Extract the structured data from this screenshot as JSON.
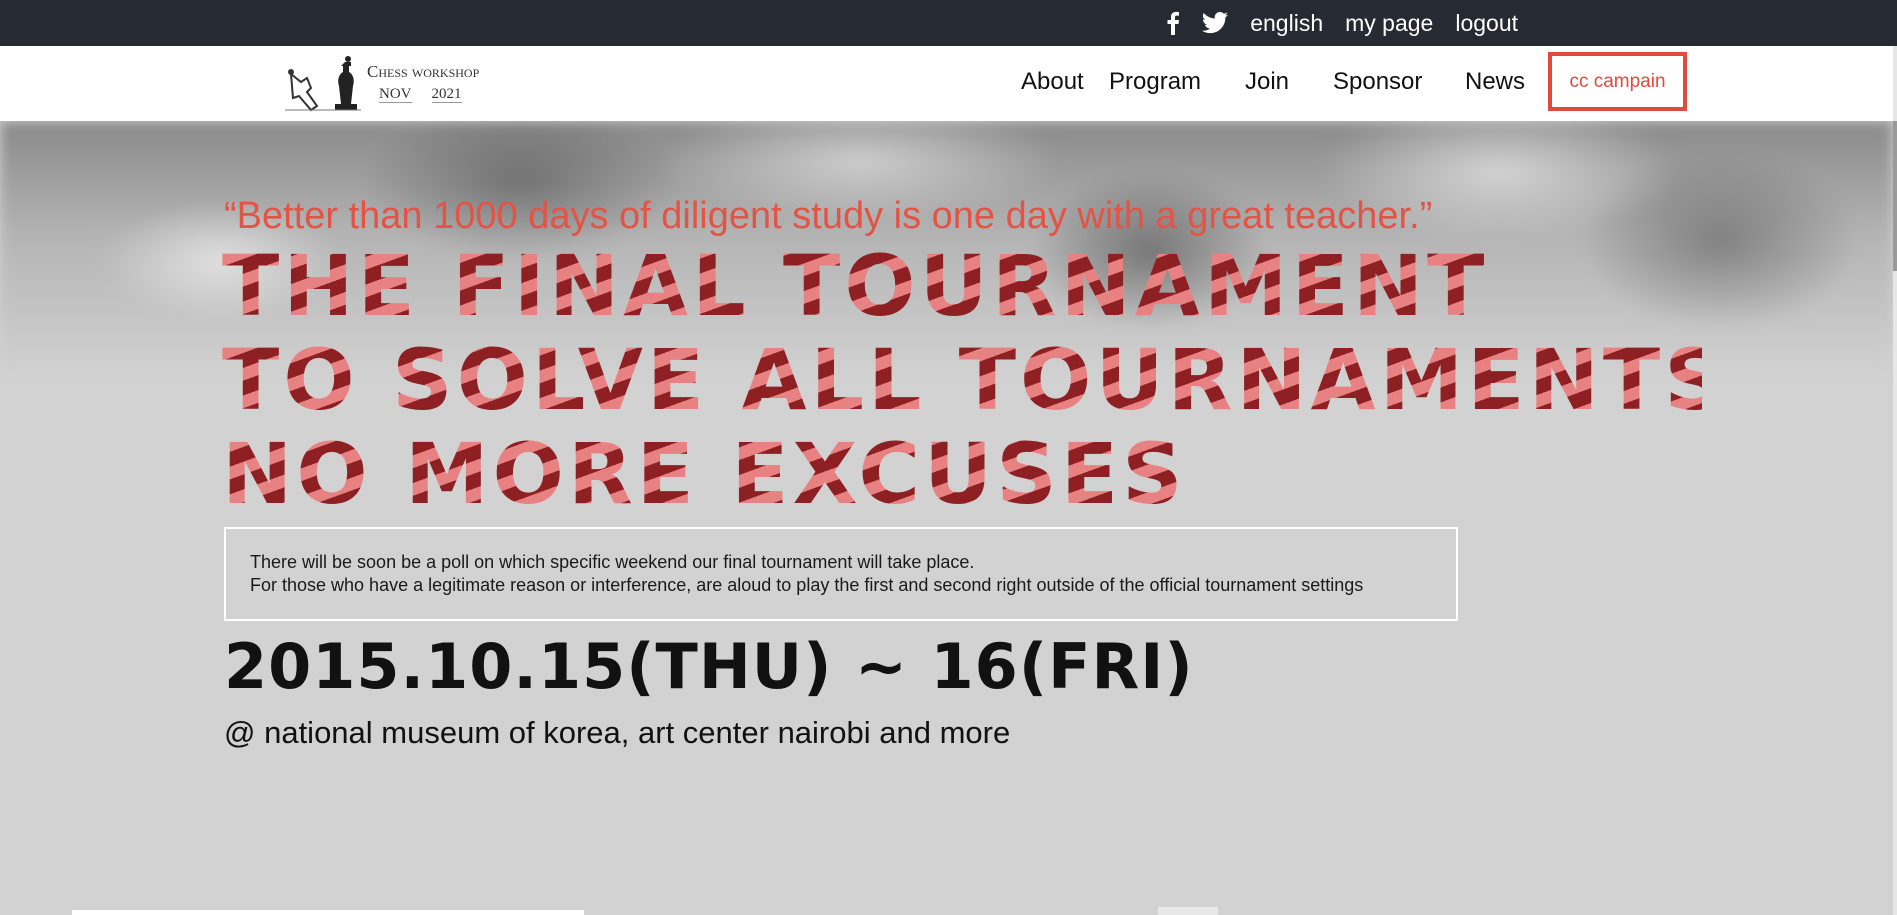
{
  "topbar": {
    "icons": [
      "facebook-icon",
      "twitter-icon"
    ],
    "language": "english",
    "my_page": "my page",
    "logout": "logout"
  },
  "logo": {
    "title": "Chess workshop",
    "month": "NOV",
    "year": "2021"
  },
  "nav": {
    "items": [
      {
        "label": "About"
      },
      {
        "label": "Program"
      },
      {
        "label": "Join"
      },
      {
        "label": "Sponsor"
      },
      {
        "label": "News"
      }
    ],
    "cta": "cc campain"
  },
  "hero": {
    "quote": "“Better than 1000 days of diligent study is one day with a great teacher.”",
    "headline": [
      "THE FINAL TOURNAMENT",
      "TO SOLVE ALL TOURNAMENTS",
      "NO MORE EXCUSES"
    ],
    "notice": [
      "There will be soon be a poll on which specific weekend our final tournament will take place.",
      "For those who have a legitimate reason or interference, are aloud to play the first and second right outside of the official tournament settings"
    ],
    "date": "2015.10.15(THU) ~ 16(FRI)",
    "venue": "@ national museum of korea, art center nairobi and more"
  },
  "colors": {
    "topbar": "#262a33",
    "accent": "#e0493c",
    "headline_dark": "#8e1f22",
    "headline_light": "#e88282",
    "hero_bg": "#d2d2d2"
  }
}
